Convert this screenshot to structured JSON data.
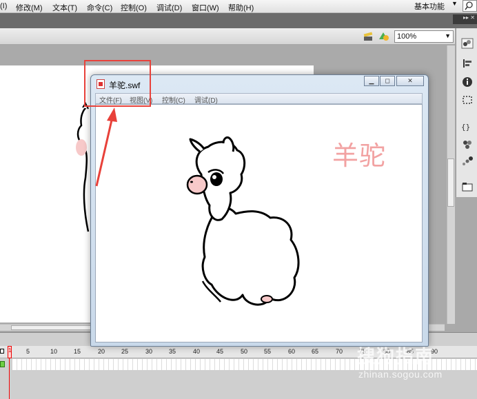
{
  "menubar": {
    "items": [
      "(I)",
      "修改(M)",
      "文本(T)",
      "命令(C)",
      "控制(O)",
      "调试(D)",
      "窗口(W)",
      "帮助(H)"
    ],
    "workspace": "基本功能"
  },
  "toolbar": {
    "zoom": "100%"
  },
  "timeline": {
    "current_frame": "1",
    "ticks": [
      "5",
      "10",
      "15",
      "20",
      "25",
      "30",
      "35",
      "40",
      "45",
      "50",
      "55",
      "60",
      "65",
      "70",
      "75",
      "80",
      "85",
      "90"
    ]
  },
  "player": {
    "title": "羊驼.swf",
    "menu": [
      "文件(F)",
      "视图(V)",
      "控制(C)",
      "调试(D)"
    ],
    "content_text": "羊驼"
  },
  "watermark": {
    "main": "搜狗指南",
    "sub": "zhinan.sogou.com"
  },
  "colors": {
    "annotation": "#e8413a",
    "alpaca_text": "#f2a2a2",
    "playhead": "#ee0000"
  }
}
